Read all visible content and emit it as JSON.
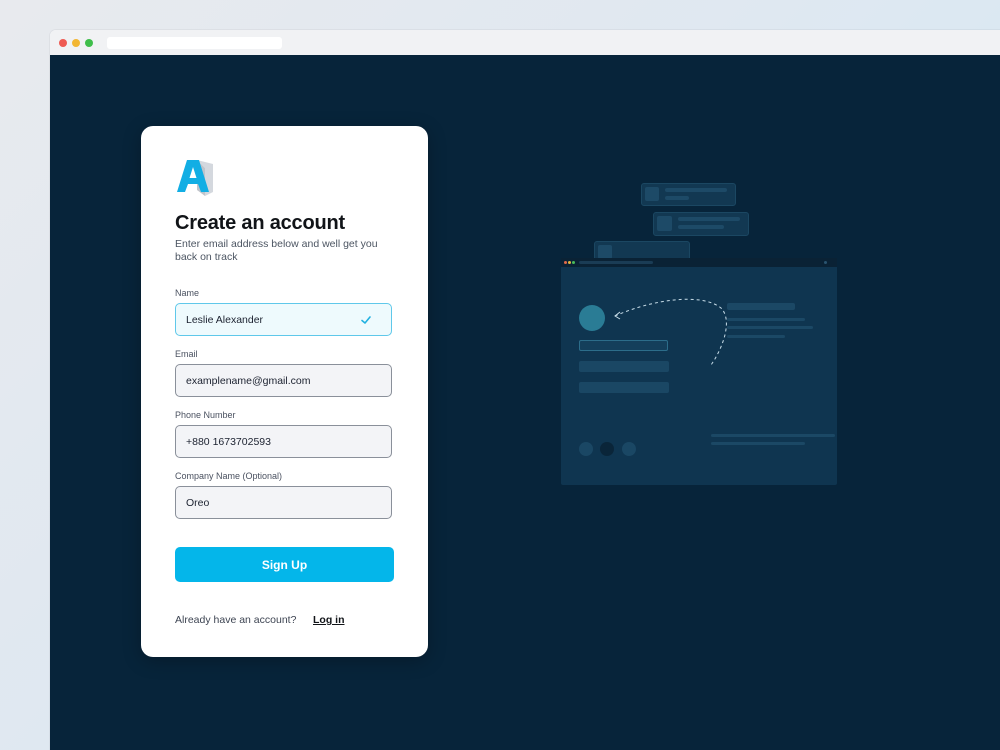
{
  "form": {
    "title": "Create an account",
    "subtitle": "Enter email address below and well get you back on track",
    "fields": [
      {
        "label": "Name",
        "value": "Leslie Alexander",
        "state": "valid"
      },
      {
        "label": "Email",
        "value": "examplename@gmail.com"
      },
      {
        "label": "Phone Number",
        "value": "+880 1673702593"
      },
      {
        "label": "Company Name (Optional)",
        "value": "Oreo"
      }
    ],
    "submit_label": "Sign Up",
    "footer_text": "Already have an account?",
    "login_label": "Log in"
  },
  "icons": {
    "logo": "logo-icon",
    "valid": "checkmark-icon"
  },
  "colors": {
    "page_background": "#07243a",
    "accent": "#04b6ea",
    "valid_field_border": "#5fc8ea",
    "illustration_accent": "#2a7c95"
  }
}
